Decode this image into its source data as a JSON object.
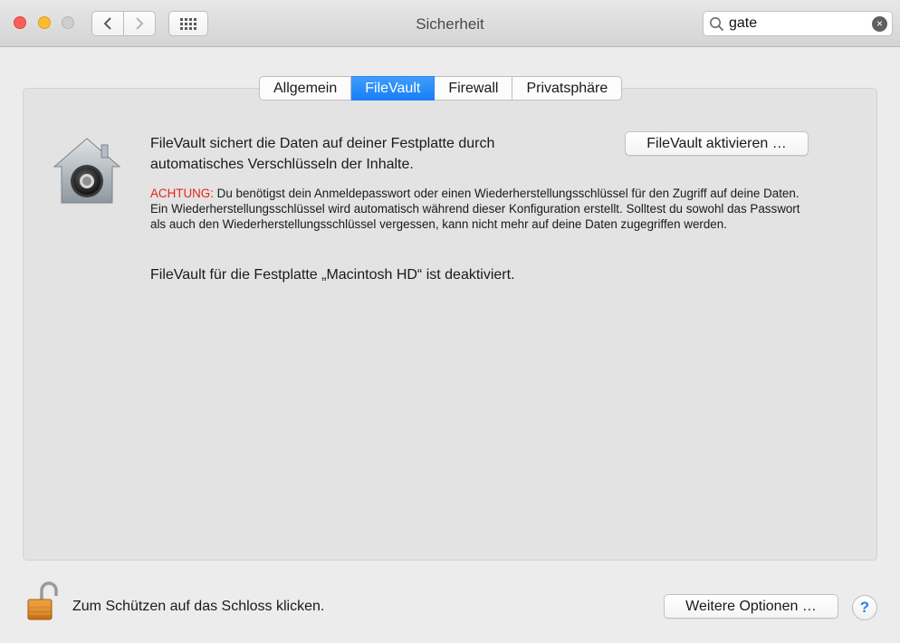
{
  "window": {
    "title": "Sicherheit"
  },
  "search": {
    "value": "gate",
    "clear_icon": "×"
  },
  "tabs": [
    {
      "label": "Allgemein",
      "active": false
    },
    {
      "label": "FileVault",
      "active": true
    },
    {
      "label": "Firewall",
      "active": false
    },
    {
      "label": "Privatsphäre",
      "active": false
    }
  ],
  "filevault": {
    "description": "FileVault sichert die Daten auf deiner Festplatte durch automatisches Verschlüsseln der Inhalte.",
    "activate_button": "FileVault aktivieren …",
    "warning_label": "ACHTUNG:",
    "warning_text": " Du benötigst dein Anmeldepasswort oder einen Wiederherstellungsschlüssel für den Zugriff auf deine Daten. Ein Wiederherstellungsschlüssel wird automatisch während dieser Konfiguration erstellt. Solltest du sowohl das Passwort als auch den Wiederherstellungsschlüssel vergessen, kann nicht mehr auf deine Daten zugegriffen werden.",
    "status": "FileVault für die Festplatte „Macintosh HD“ ist deaktiviert."
  },
  "footer": {
    "lock_label": "Zum Schützen auf das Schloss klicken.",
    "options_button": "Weitere Optionen …",
    "help_label": "?"
  },
  "colors": {
    "accent": "#1a7ef5",
    "warning": "#e8231d",
    "close": "#fc5f57",
    "minimize": "#fdbc2e",
    "zoom": "#cfcdcf"
  },
  "icons": {
    "close": "close-window-icon",
    "minimize": "minimize-window-icon",
    "zoom": "zoom-window-icon",
    "back": "chevron-left-icon",
    "forward": "chevron-right-icon",
    "grid": "grid-icon",
    "search": "search-icon",
    "clear": "clear-search-icon",
    "filevault": "filevault-house-icon",
    "lock": "lock-open-icon"
  }
}
